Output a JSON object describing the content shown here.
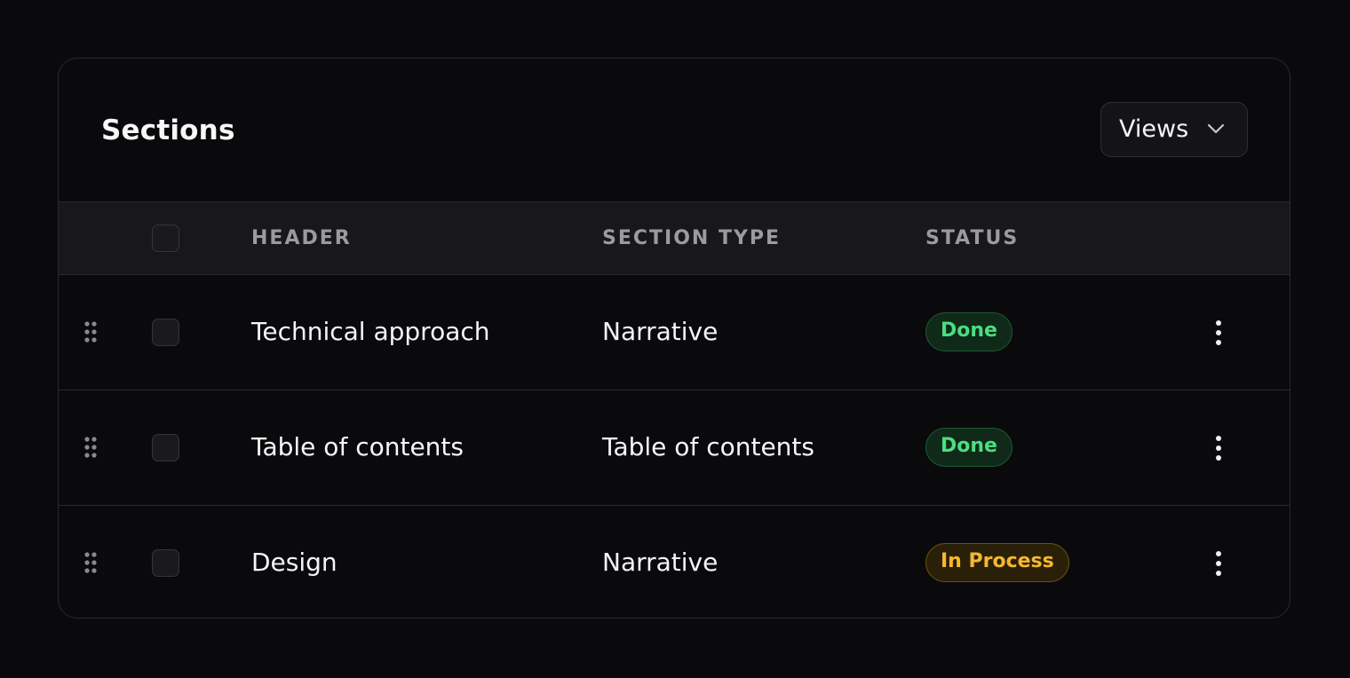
{
  "card": {
    "title": "Sections",
    "views_label": "Views"
  },
  "table": {
    "columns": [
      "HEADER",
      "SECTION TYPE",
      "STATUS"
    ],
    "rows": [
      {
        "header": "Technical approach",
        "section_type": "Narrative",
        "status": "Done"
      },
      {
        "header": "Table of contents",
        "section_type": "Table of contents",
        "status": "Done"
      },
      {
        "header": "Design",
        "section_type": "Narrative",
        "status": "In Process"
      }
    ]
  },
  "icons": {
    "views": "chevron-down-icon",
    "drag": "drag-handle-icon",
    "row_menu": "more-vertical-icon"
  },
  "colors": {
    "background": "#0a0a0c",
    "status_done_text": "#4ade80",
    "status_done_bg": "#0f2a18",
    "status_done_border": "#1f5a33",
    "status_in_process_text": "#f5b82e",
    "status_in_process_bg": "#2a200a",
    "status_in_process_border": "#6b5216"
  }
}
